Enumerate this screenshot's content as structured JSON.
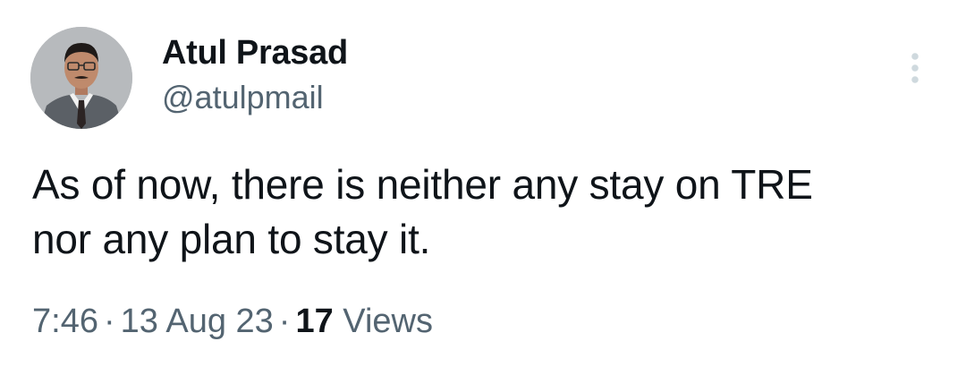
{
  "author": {
    "name": "Atul Prasad",
    "handle": "@atulpmail",
    "avatar_icon": "profile-photo"
  },
  "tweet": {
    "text_line_1": "As of now, there is neither any stay on TRE",
    "text_line_2": "nor any plan to stay it."
  },
  "meta": {
    "time": "7:46",
    "separator": "·",
    "date": "13 Aug 23",
    "views_count": "17",
    "views_label": "Views"
  },
  "colors": {
    "text_primary": "#0f1419",
    "text_secondary": "#536471",
    "more_icon": "#cfd9de"
  },
  "icons": {
    "more": "more-vertical-icon"
  }
}
